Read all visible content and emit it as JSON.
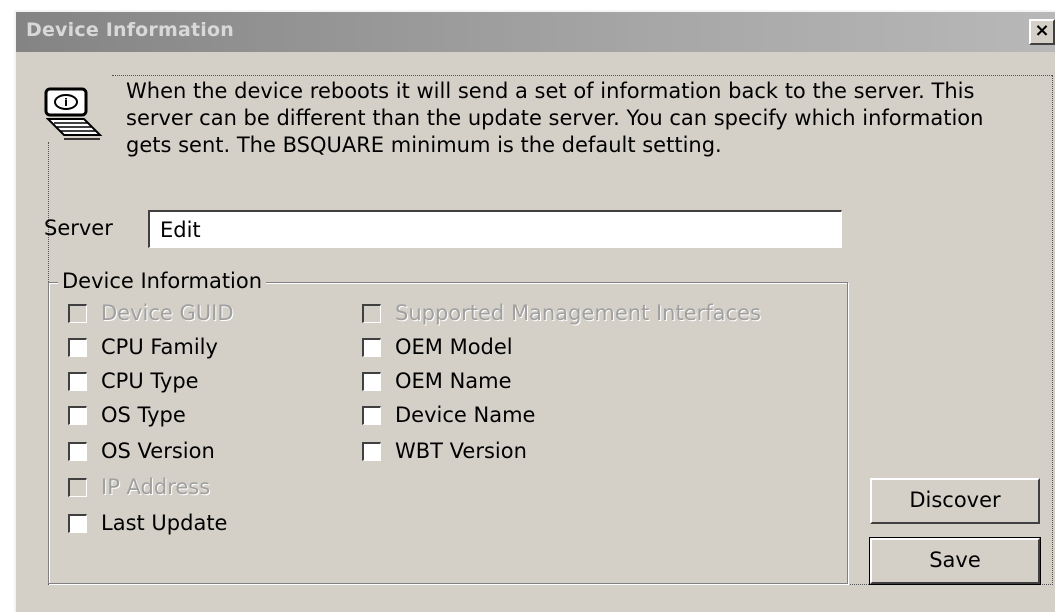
{
  "window": {
    "title": "Device Information",
    "close_label": "×"
  },
  "description": "When the device reboots it will send a set of information back to the server.  This server can be different than the update server.  You can specify which information gets sent.  The BSQUARE minimum is the default setting.",
  "server": {
    "label": "Server",
    "value": "Edit"
  },
  "group": {
    "title": "Device Information",
    "left": [
      {
        "label": "Device GUID",
        "enabled": false,
        "checked": false
      },
      {
        "label": "CPU Family",
        "enabled": true,
        "checked": false
      },
      {
        "label": "CPU Type",
        "enabled": true,
        "checked": false
      },
      {
        "label": "OS Type",
        "enabled": true,
        "checked": false
      },
      {
        "label": "OS Version",
        "enabled": true,
        "checked": false
      },
      {
        "label": "IP Address",
        "enabled": false,
        "checked": false
      },
      {
        "label": "Last Update",
        "enabled": true,
        "checked": false
      }
    ],
    "right": [
      {
        "label": "Supported Management Interfaces",
        "enabled": false,
        "checked": false
      },
      {
        "label": "OEM Model",
        "enabled": true,
        "checked": false
      },
      {
        "label": "OEM Name",
        "enabled": true,
        "checked": false
      },
      {
        "label": "Device Name",
        "enabled": true,
        "checked": false
      },
      {
        "label": "WBT Version",
        "enabled": true,
        "checked": false
      }
    ]
  },
  "buttons": {
    "discover": "Discover",
    "save": "Save"
  },
  "icons": {
    "close": "close-icon",
    "info": "device-info-icon"
  },
  "colors": {
    "titlebar": "#848484",
    "face": "#d4d0c8",
    "disabled_text": "#a0a0a0"
  }
}
